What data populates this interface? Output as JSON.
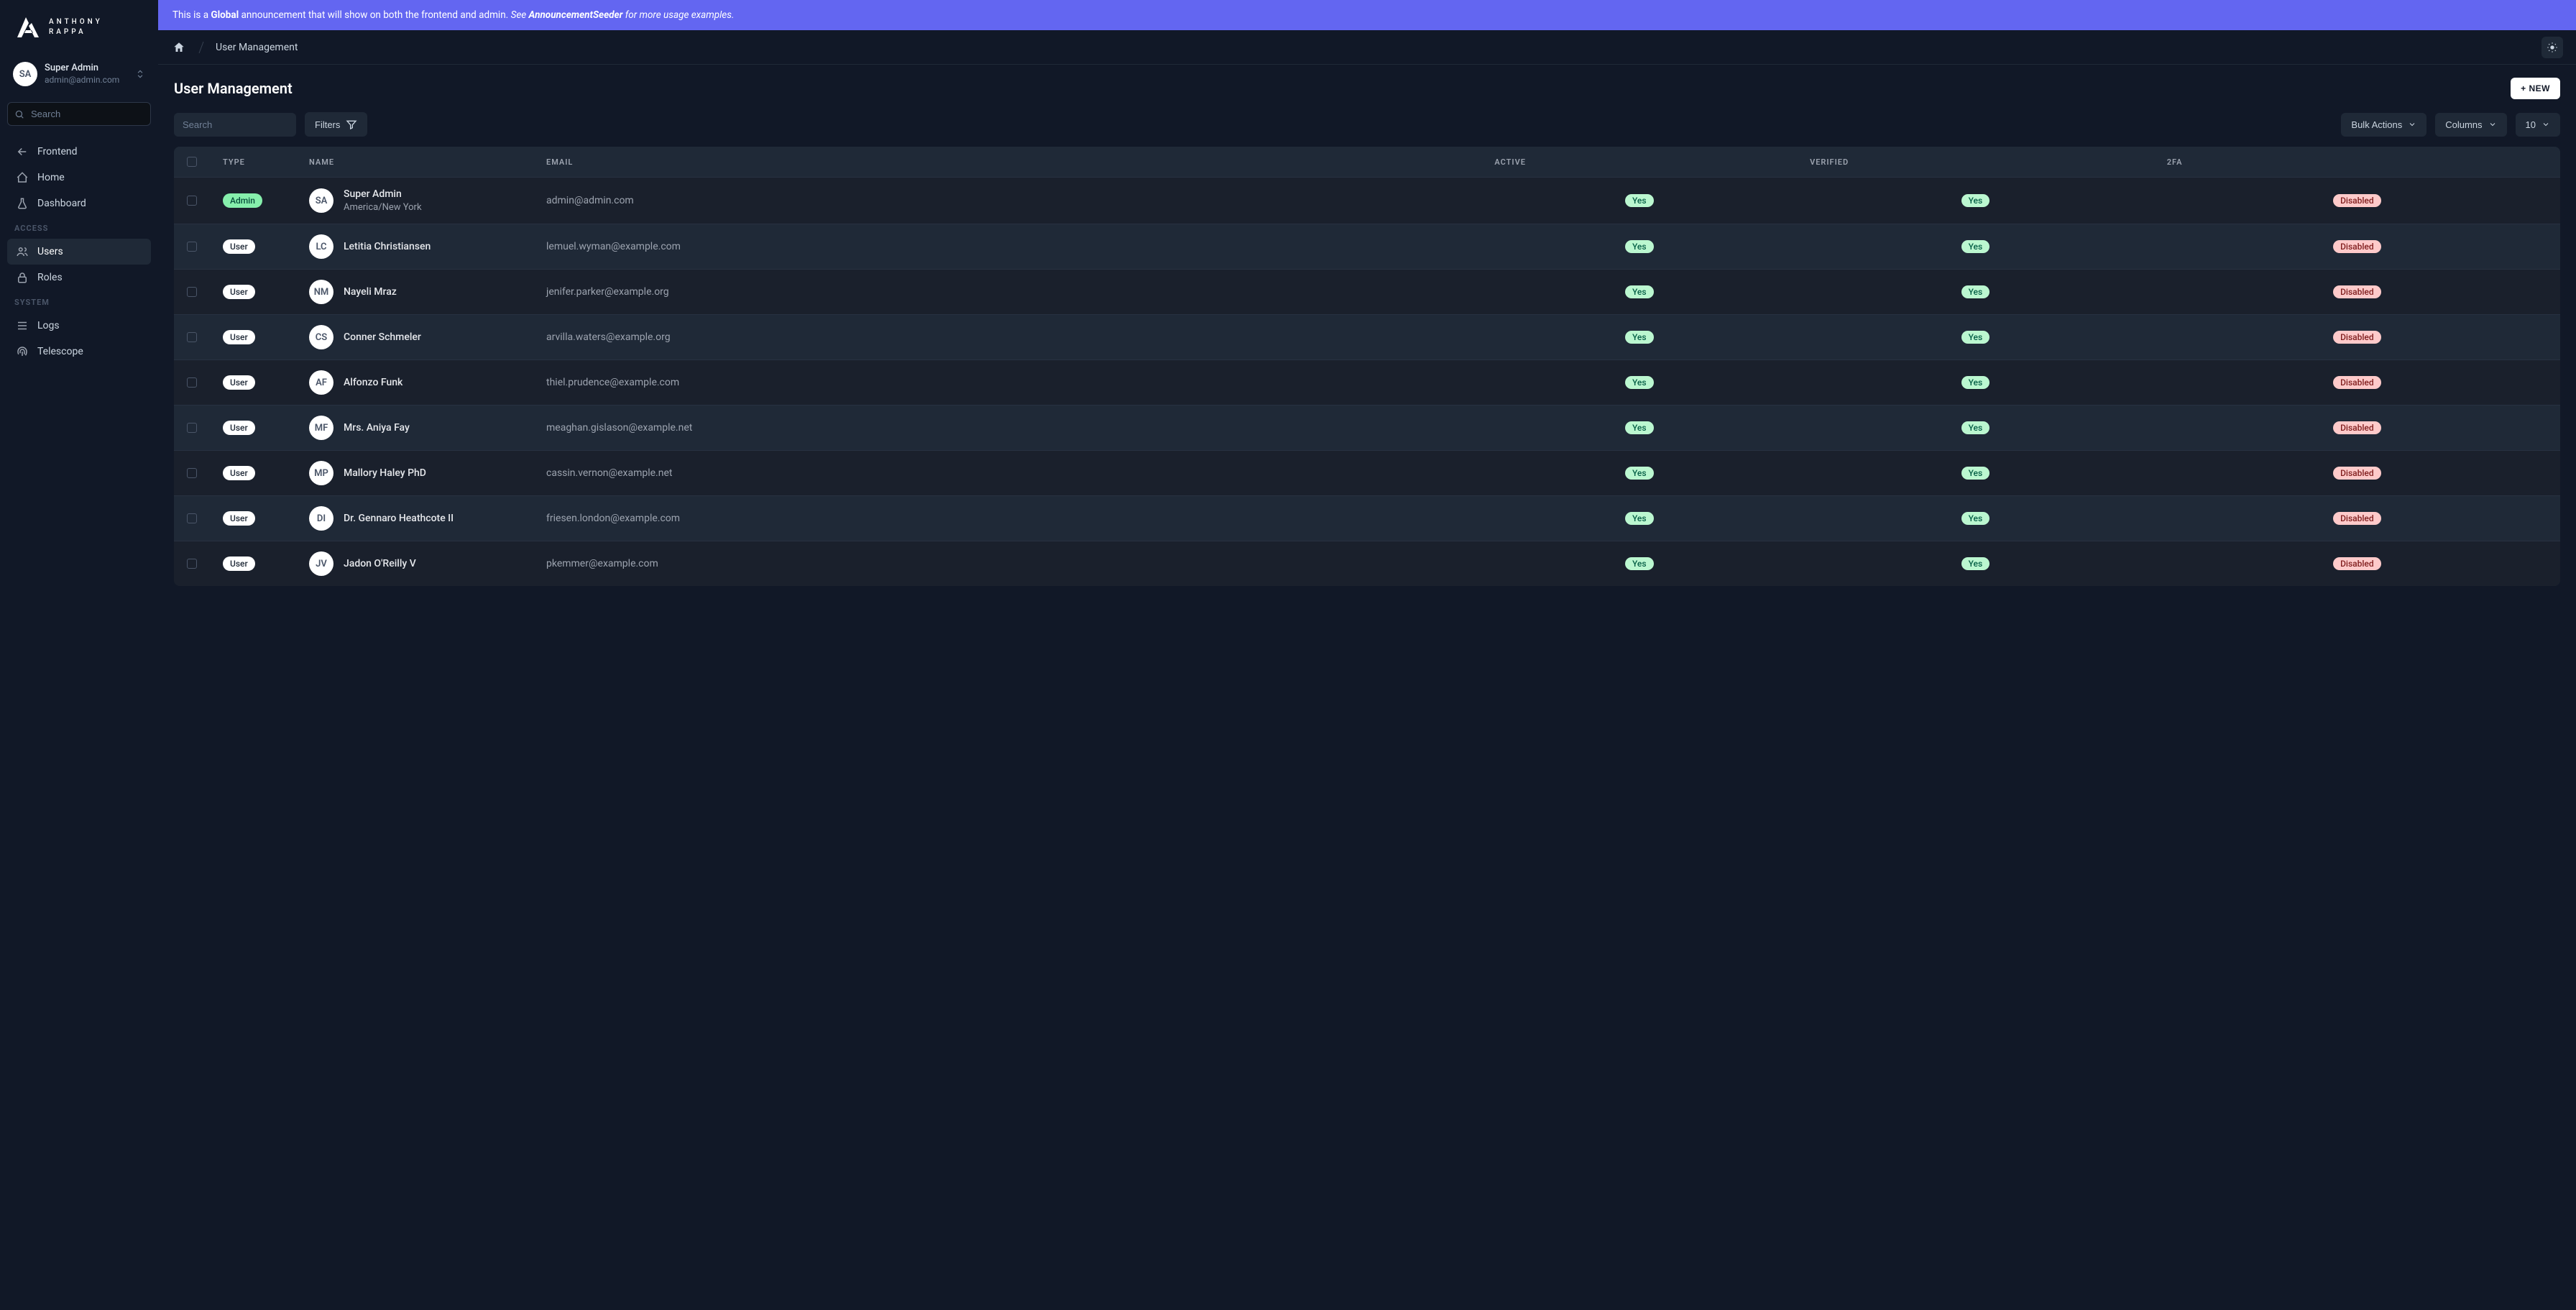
{
  "brand": {
    "line1": "ANTHONY",
    "line2": "RAPPA"
  },
  "current_user": {
    "initials": "SA",
    "name": "Super Admin",
    "email": "admin@admin.com"
  },
  "sidebar": {
    "search_placeholder": "Search",
    "top_items": [
      {
        "label": "Frontend",
        "icon": "arrow-left"
      },
      {
        "label": "Home",
        "icon": "home"
      },
      {
        "label": "Dashboard",
        "icon": "beaker"
      }
    ],
    "sections": [
      {
        "heading": "ACCESS",
        "items": [
          {
            "label": "Users",
            "icon": "users",
            "active": true
          },
          {
            "label": "Roles",
            "icon": "lock"
          }
        ]
      },
      {
        "heading": "SYSTEM",
        "items": [
          {
            "label": "Logs",
            "icon": "list"
          },
          {
            "label": "Telescope",
            "icon": "fingerprint"
          }
        ]
      }
    ]
  },
  "announcement": {
    "prefix": "This is a ",
    "bold1": "Global",
    "mid": " announcement that will show on both the frontend and admin. ",
    "italic_pre": "See ",
    "bold2": "AnnouncementSeeder",
    "italic_post": " for more usage examples."
  },
  "breadcrumb": {
    "current": "User Management"
  },
  "page": {
    "title": "User Management",
    "new_button": "+ NEW"
  },
  "toolbar": {
    "search_placeholder": "Search",
    "filters": "Filters",
    "bulk_actions": "Bulk Actions",
    "columns": "Columns",
    "per_page": "10"
  },
  "table": {
    "headers": {
      "type": "TYPE",
      "name": "NAME",
      "email": "EMAIL",
      "active": "ACTIVE",
      "verified": "VERIFIED",
      "twofa": "2FA"
    },
    "rows": [
      {
        "type": "Admin",
        "initials": "SA",
        "name": "Super Admin",
        "sub": "America/New York",
        "email": "admin@admin.com",
        "active": "Yes",
        "verified": "Yes",
        "twofa": "Disabled"
      },
      {
        "type": "User",
        "initials": "LC",
        "name": "Letitia Christiansen",
        "sub": "",
        "email": "lemuel.wyman@example.com",
        "active": "Yes",
        "verified": "Yes",
        "twofa": "Disabled"
      },
      {
        "type": "User",
        "initials": "NM",
        "name": "Nayeli Mraz",
        "sub": "",
        "email": "jenifer.parker@example.org",
        "active": "Yes",
        "verified": "Yes",
        "twofa": "Disabled"
      },
      {
        "type": "User",
        "initials": "CS",
        "name": "Conner Schmeler",
        "sub": "",
        "email": "arvilla.waters@example.org",
        "active": "Yes",
        "verified": "Yes",
        "twofa": "Disabled"
      },
      {
        "type": "User",
        "initials": "AF",
        "name": "Alfonzo Funk",
        "sub": "",
        "email": "thiel.prudence@example.com",
        "active": "Yes",
        "verified": "Yes",
        "twofa": "Disabled"
      },
      {
        "type": "User",
        "initials": "MF",
        "name": "Mrs. Aniya Fay",
        "sub": "",
        "email": "meaghan.gislason@example.net",
        "active": "Yes",
        "verified": "Yes",
        "twofa": "Disabled"
      },
      {
        "type": "User",
        "initials": "MP",
        "name": "Mallory Haley PhD",
        "sub": "",
        "email": "cassin.vernon@example.net",
        "active": "Yes",
        "verified": "Yes",
        "twofa": "Disabled"
      },
      {
        "type": "User",
        "initials": "DI",
        "name": "Dr. Gennaro Heathcote II",
        "sub": "",
        "email": "friesen.london@example.com",
        "active": "Yes",
        "verified": "Yes",
        "twofa": "Disabled"
      },
      {
        "type": "User",
        "initials": "JV",
        "name": "Jadon O'Reilly V",
        "sub": "",
        "email": "pkemmer@example.com",
        "active": "Yes",
        "verified": "Yes",
        "twofa": "Disabled"
      }
    ]
  }
}
